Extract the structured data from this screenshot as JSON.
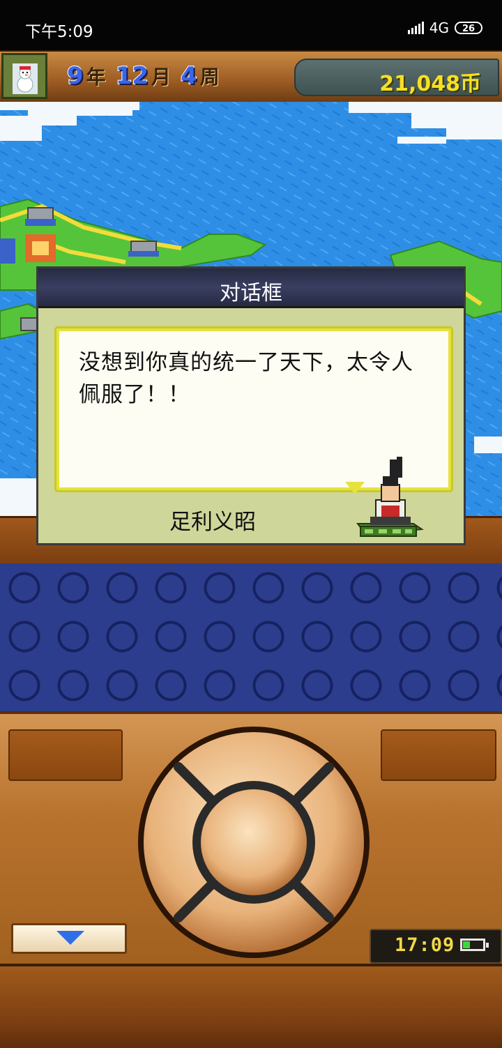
{
  "status_bar": {
    "time": "下午5:09",
    "network": "4G",
    "battery": "26"
  },
  "header": {
    "year_num": "9",
    "year_unit": "年",
    "month_num": "12",
    "month_unit": "月",
    "week_num": "4",
    "week_unit": "周",
    "money": "21,048币",
    "avatar_icon": "snowman-icon"
  },
  "dialog": {
    "title": "对话框",
    "message": "没想到你真的统一了天下，太令人佩服了！！",
    "speaker": "足利义昭",
    "portrait_icon": "samurai-portrait-icon"
  },
  "controls": {
    "clock": "17:09",
    "scroll_icon": "down-arrow-icon",
    "dpad_icon": "dpad-icon",
    "battery_icon": "battery-icon"
  },
  "colors": {
    "sea": "#2e8ee6",
    "land": "#56c43a",
    "road": "#f2dc3a",
    "money_text": "#f6df24",
    "dialog_bg": "#cfd69a",
    "speech_border": "#e6e23c"
  }
}
